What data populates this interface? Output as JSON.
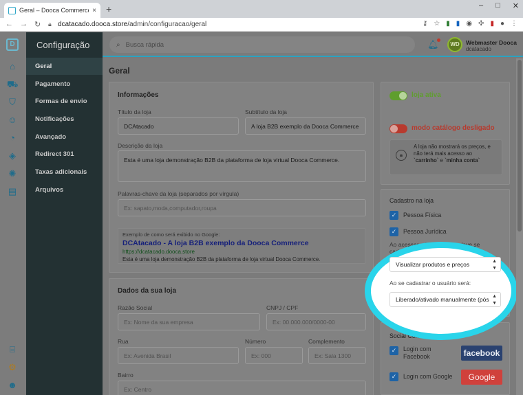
{
  "browser": {
    "tab_title": "Geral – Dooca Commerce",
    "tab_close": "×",
    "new_tab": "+",
    "url_host": "dcatacado.dooca.store",
    "url_path": "/admin/configuracao/geral",
    "window_controls": [
      "–",
      "□",
      "✕"
    ]
  },
  "sidebar": {
    "title": "Configuração",
    "items": [
      {
        "label": "Geral",
        "active": true
      },
      {
        "label": "Pagamento"
      },
      {
        "label": "Formas de envio"
      },
      {
        "label": "Notificações"
      },
      {
        "label": "Avançado"
      },
      {
        "label": "Redirect 301"
      },
      {
        "label": "Taxas adicionais"
      },
      {
        "label": "Arquivos"
      }
    ]
  },
  "topbar": {
    "search_placeholder": "Busca rápida",
    "user_initials": "WD",
    "user_name": "Webmaster Dooca",
    "user_store": "dcatacado"
  },
  "page": {
    "title": "Geral"
  },
  "info": {
    "heading": "Informações",
    "store_title_label": "Título da loja",
    "store_title_value": "DCAtacado",
    "subtitle_label": "Subtítulo da loja",
    "subtitle_value": "A loja B2B exemplo da Dooca Commerce",
    "description_label": "Descrição da loja",
    "description_value": "Esta é uma loja demonstração B2B da plataforma de loja virtual Dooca Commerce.",
    "keywords_label": "Palavras-chave da loja (separados por vírgula)",
    "keywords_placeholder": "Ex: sapato,moda,computador,roupa",
    "preview_hint": "Exemplo de como será exibido no Google:",
    "preview_title": "DCAtacado - A loja B2B exemplo da Dooca Commerce",
    "preview_url": "https://dcatacado.dooca.store",
    "preview_desc": "Esta é uma loja demonstração B2B da plataforma de loja virtual Dooca Commerce."
  },
  "store_data": {
    "heading": "Dados da sua loja",
    "company_label": "Razão Social",
    "company_placeholder": "Ex: Nome da sua empresa",
    "cnpj_label": "CNPJ / CPF",
    "cnpj_placeholder": "Ex: 00.000.000/0000-00",
    "street_label": "Rua",
    "street_placeholder": "Ex: Avenida Brasil",
    "number_label": "Número",
    "number_placeholder": "Ex: 000",
    "complement_label": "Complemento",
    "complement_placeholder": "Ex: Sala 1300",
    "district_label": "Bairro",
    "district_placeholder": "Ex: Centro"
  },
  "status": {
    "store_active_label": "loja ativa",
    "catalog_mode_label": "modo catálogo desligado",
    "catalog_info_1": "A loja não mostrará os preços, e não terá mais acesso ao ",
    "catalog_info_cart": "`carrinho`",
    "catalog_info_2": " e ",
    "catalog_info_account": "`minha conta`",
    "colors": {
      "on": "#5f9e2e",
      "off": "#b83a2e"
    }
  },
  "register": {
    "heading": "Cadastro na loja",
    "options": [
      {
        "label": "Pessoa Física",
        "checked": true
      },
      {
        "label": "Pessoa Jurídica",
        "checked": true
      }
    ],
    "access_hint": "Ao acessar a loja o cliente deve se cadastrar para:",
    "access_select": "Visualizar produtos e preços",
    "signup_hint": "Ao se cadastrar o usuário será:",
    "signup_select": "Liberado/ativado manualmente (pós"
  },
  "social": {
    "heading": "Social Connect",
    "facebook_label": "Login com Facebook",
    "facebook_button": "facebook",
    "google_label": "Login com Google",
    "google_button": "Google"
  },
  "highlight_color": "#29d4ea"
}
